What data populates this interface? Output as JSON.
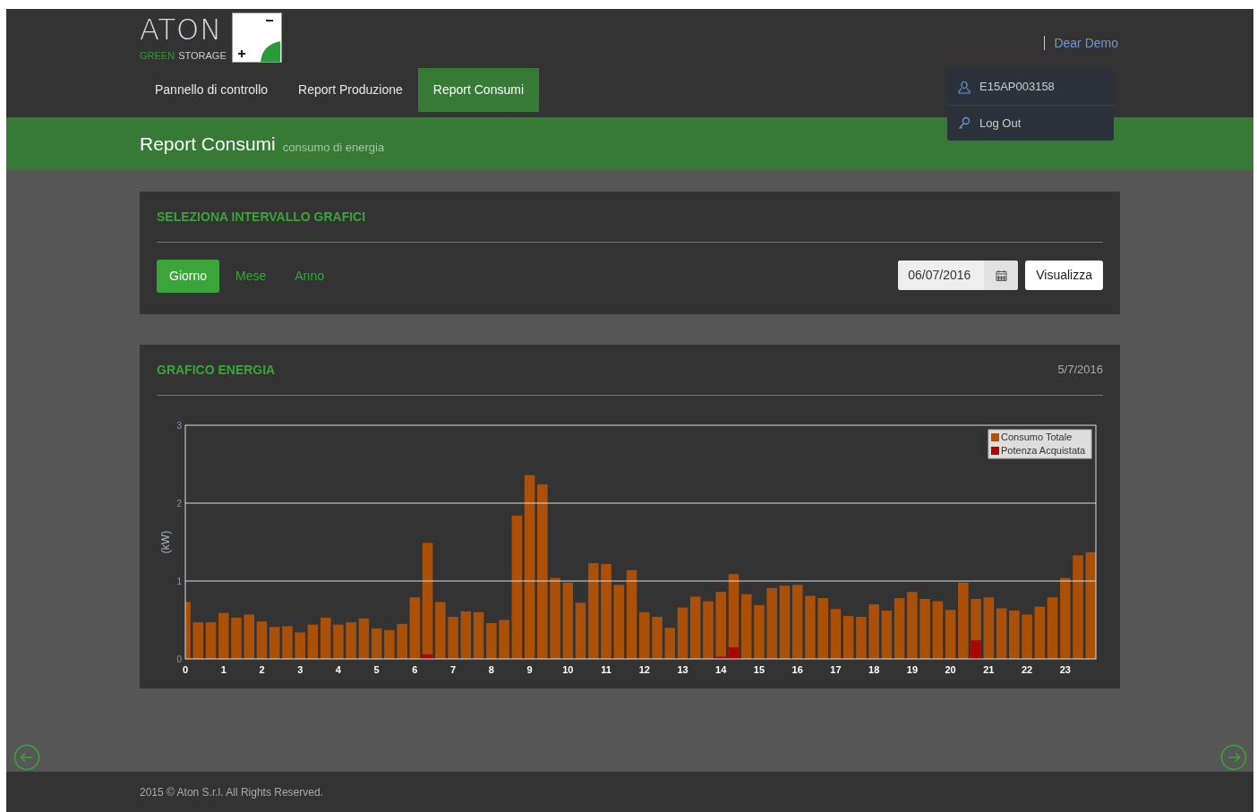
{
  "header": {
    "logo": {
      "wordmark": "ATON",
      "tagline_green": "GREEN",
      "tagline_grey": "STORAGE"
    },
    "nav_tabs": [
      {
        "label": "Pannello di controllo",
        "selected": false
      },
      {
        "label": "Report Produzione",
        "selected": false
      },
      {
        "label": "Report Consumi",
        "selected": true
      }
    ],
    "user_greeting": "Dear Demo",
    "user_menu": [
      {
        "kind": "user",
        "label": "E15AP003158"
      },
      {
        "kind": "logout",
        "label": "Log Out"
      }
    ]
  },
  "page_title": {
    "title": "Report Consumi",
    "subtitle": "consumo di energia"
  },
  "interval_panel": {
    "title": "SELEZIONA INTERVALLO GRAFICI",
    "periods": [
      {
        "label": "Giorno",
        "selected": true
      },
      {
        "label": "Mese",
        "selected": false
      },
      {
        "label": "Anno",
        "selected": false
      }
    ],
    "date_field": {
      "value": "06/07/2016"
    },
    "button": "Visualizza"
  },
  "chart_panel": {
    "title": "GRAFICO ENERGIA",
    "date": "5/7/2016",
    "chart_data": {
      "type": "bar",
      "ylabel": "(kW)",
      "stacked": false,
      "legend": true,
      "xlim": [
        0,
        23.8
      ],
      "ylim": [
        0,
        3
      ],
      "xticks": [
        0,
        1,
        2,
        3,
        4,
        5,
        6,
        7,
        8,
        9,
        10,
        11,
        12,
        13,
        14,
        15,
        16,
        17,
        18,
        19,
        20,
        21,
        22,
        23
      ],
      "yticks": [
        0,
        1,
        2,
        3
      ],
      "x": [
        0,
        0.333,
        0.667,
        1,
        1.333,
        1.667,
        2,
        2.333,
        2.667,
        3,
        3.333,
        3.667,
        4,
        4.333,
        4.667,
        5,
        5.333,
        5.667,
        6,
        6.333,
        6.667,
        7,
        7.333,
        7.667,
        8,
        8.333,
        8.667,
        9,
        9.333,
        9.667,
        10,
        10.333,
        10.667,
        11,
        11.333,
        11.667,
        12,
        12.333,
        12.667,
        13,
        13.333,
        13.667,
        14,
        14.333,
        14.667,
        15,
        15.333,
        15.667,
        16,
        16.333,
        16.667,
        17,
        17.333,
        17.667,
        18,
        18.333,
        18.667,
        19,
        19.333,
        19.667,
        20,
        20.333,
        20.667,
        21,
        21.333,
        21.667,
        22,
        22.333,
        22.667,
        23,
        23.333,
        23.667
      ],
      "series": [
        {
          "name": "Consumo Totale",
          "color": "#b25206",
          "values": [
            0.73,
            0.47,
            0.47,
            0.59,
            0.53,
            0.57,
            0.48,
            0.41,
            0.42,
            0.34,
            0.44,
            0.53,
            0.44,
            0.47,
            0.52,
            0.39,
            0.37,
            0.45,
            0.79,
            1.49,
            0.73,
            0.54,
            0.61,
            0.6,
            0.46,
            0.5,
            1.84,
            2.36,
            2.24,
            1.04,
            0.98,
            0.72,
            1.23,
            1.22,
            0.95,
            1.14,
            0.6,
            0.54,
            0.4,
            0.66,
            0.8,
            0.74,
            0.86,
            1.09,
            0.83,
            0.69,
            0.91,
            0.94,
            0.95,
            0.81,
            0.78,
            0.64,
            0.55,
            0.54,
            0.7,
            0.62,
            0.78,
            0.86,
            0.77,
            0.74,
            0.63,
            0.98,
            0.77,
            0.79,
            0.65,
            0.62,
            0.57,
            0.67,
            0.79,
            1.04,
            1.33,
            1.37
          ]
        },
        {
          "name": "Potenza Acquistata",
          "color": "#b00000",
          "values": [
            0,
            0,
            0,
            0,
            0,
            0,
            0,
            0,
            0,
            0,
            0,
            0,
            0,
            0,
            0,
            0,
            0,
            0,
            0,
            0.06,
            0,
            0,
            0,
            0,
            0,
            0,
            0,
            0,
            0,
            0,
            0,
            0,
            0,
            0,
            0,
            0,
            0,
            0,
            0,
            0,
            0,
            0,
            0.03,
            0.15,
            0,
            0,
            0,
            0,
            0,
            0,
            0,
            0,
            0,
            0,
            0,
            0,
            0,
            0,
            0,
            0,
            0,
            0,
            0.24,
            0,
            0,
            0,
            0,
            0,
            0,
            0,
            0,
            0
          ]
        }
      ]
    }
  },
  "footer": "2015 © Aton S.r.l. All Rights Reserved."
}
